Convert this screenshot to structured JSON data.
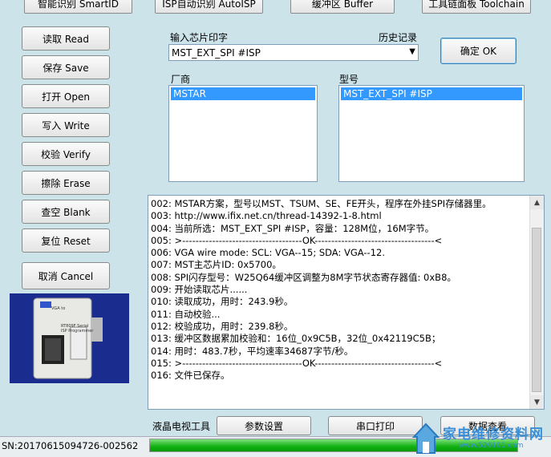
{
  "top_buttons": {
    "smartid": "智能识别 SmartID",
    "autoisp": "ISP自动识别 AutoISP",
    "buffer": "缓冲区 Buffer",
    "toolchain": "工具链面板 Toolchain"
  },
  "sidebar": {
    "read": "读取 Read",
    "save": "保存 Save",
    "open": "打开 Open",
    "write": "写入 Write",
    "verify": "校验 Verify",
    "erase": "擦除 Erase",
    "blank": "查空 Blank",
    "reset": "复位 Reset",
    "cancel": "取消 Cancel"
  },
  "device_photo": {
    "label1": "VGA to",
    "label2": "RT809F Serial",
    "label3": "ISP Programmer"
  },
  "chip_input": {
    "label": "输入芯片印字",
    "history_label": "历史记录",
    "value": "MST_EXT_SPI #ISP",
    "confirm": "确定 OK"
  },
  "manufacturer": {
    "label": "厂商",
    "selected": "MSTAR"
  },
  "model": {
    "label": "型号",
    "selected": "MST_EXT_SPI #ISP"
  },
  "log": {
    "lines": [
      "002:  MSTAR方案，型号以MST、TSUM、SE、FE开头，程序在外挂SPI存储器里。",
      "003:  http://www.ifix.net.cn/thread-14392-1-8.html",
      "004:  当前所选：MST_EXT_SPI #ISP，容量：128M位，16M字节。",
      "005:  >------------------------------------OK------------------------------------<",
      "006:  VGA wire mode: SCL: VGA--15; SDA: VGA--12.",
      "007:  MST主芯片ID: 0x5700。",
      "008:  SPI闪存型号：W25Q64缓冲区调整为8M字节状态寄存器值: 0xB8。",
      "009:  开始读取芯片......",
      "010:  读取成功，用时：243.9秒。",
      "011:  自动校验...",
      "012:  校验成功，用时：239.8秒。",
      "013:  缓冲区数据累加校验和：16位_0x9C5B，32位_0x42119C5B；",
      "014:  用时：483.7秒，平均速率34687字节/秒。",
      "015:  >------------------------------------OK------------------------------------<",
      "016:  文件已保存。"
    ]
  },
  "bottom_bar": {
    "tv_tools": "液晶电视工具",
    "params": "参数设置",
    "serial_print": "串口打印",
    "data_view": "数据查看"
  },
  "status": {
    "serial": "SN:20170615094726-002562",
    "progress": 1.0
  },
  "watermark": {
    "text": "家电维修资料网",
    "url": "www.520101.com"
  }
}
